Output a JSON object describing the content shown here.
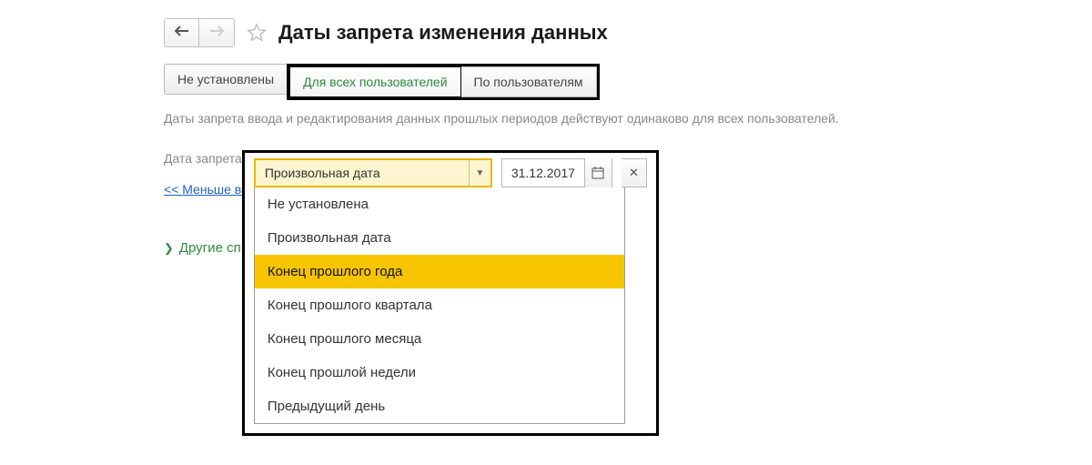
{
  "header": {
    "title": "Даты запрета изменения данных"
  },
  "tabs": {
    "not_set": "Не установлены",
    "for_all": "Для всех пользователей",
    "by_users": "По пользователям"
  },
  "description": "Даты запрета ввода и редактирования данных прошлых периодов действуют одинаково для всех пользователей.",
  "form": {
    "date_label": "Дата запрета",
    "dropdown_value": "Произвольная дата",
    "date_value": "31.12.2017"
  },
  "dropdown": {
    "items": [
      "Не установлена",
      "Произвольная дата",
      "Конец прошлого года",
      "Конец прошлого квартала",
      "Конец прошлого месяца",
      "Конец прошлой недели",
      "Предыдущий день"
    ],
    "highlighted_index": 2
  },
  "links": {
    "less": "<< Меньше во",
    "other": "Другие сп"
  }
}
